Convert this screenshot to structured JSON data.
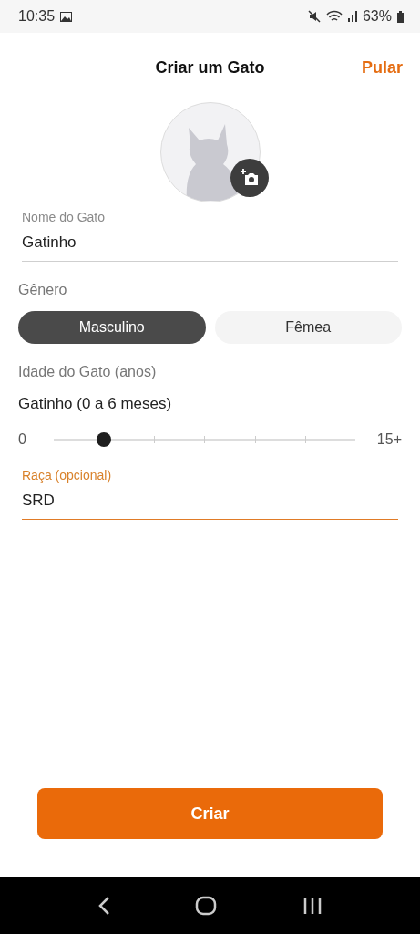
{
  "status_bar": {
    "time": "10:35",
    "battery": "63%"
  },
  "header": {
    "title": "Criar um Gato",
    "action": "Pular"
  },
  "name_field": {
    "label": "Nome do Gato",
    "value": "Gatinho",
    "focused": false
  },
  "gender": {
    "label": "Gênero",
    "options": [
      {
        "label": "Masculino",
        "selected": true
      },
      {
        "label": "Fêmea",
        "selected": false
      }
    ]
  },
  "age": {
    "label": "Idade do Gato (anos)",
    "value": "Gatinho (0 a 6 meses)",
    "min_label": "0",
    "max_label": "15+",
    "level": 0.167
  },
  "breed_field": {
    "label": "Raça (opcional)",
    "value": "SRD",
    "focused": true
  },
  "submit_button": "Criar"
}
